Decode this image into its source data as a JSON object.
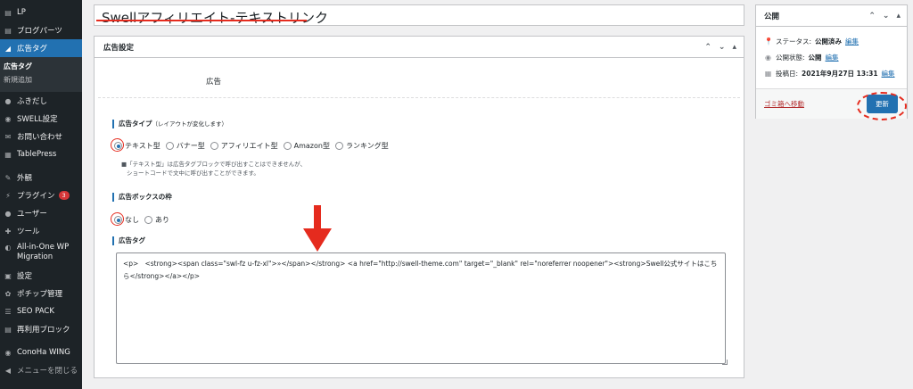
{
  "sidebar": {
    "items_top": [
      {
        "icon": "lp-icon",
        "label": "LP"
      },
      {
        "icon": "blog-parts-icon",
        "label": "ブログパーツ"
      }
    ],
    "active": {
      "icon": "megaphone-icon",
      "label": "広告タグ"
    },
    "sub": [
      "広告タグ",
      "新規追加"
    ],
    "items_mid": [
      {
        "icon": "speech-bubble-icon",
        "label": "ふきだし"
      },
      {
        "icon": "swell-icon",
        "label": "SWELL設定"
      },
      {
        "icon": "mail-icon",
        "label": "お問い合わせ"
      },
      {
        "icon": "table-icon",
        "label": "TablePress"
      }
    ],
    "items_bottom": [
      {
        "icon": "appearance-icon",
        "label": "外観"
      },
      {
        "icon": "plugin-icon",
        "label": "プラグイン",
        "badge": "3"
      },
      {
        "icon": "users-icon",
        "label": "ユーザー"
      },
      {
        "icon": "tools-icon",
        "label": "ツール"
      },
      {
        "icon": "migration-icon",
        "label": "All-in-One WP Migration"
      },
      {
        "icon": "settings-icon",
        "label": "設定"
      },
      {
        "icon": "pochipp-icon",
        "label": "ポチップ管理"
      },
      {
        "icon": "seo-icon",
        "label": "SEO PACK"
      },
      {
        "icon": "reusable-block-icon",
        "label": "再利用ブロック"
      },
      {
        "icon": "conoha-icon",
        "label": "ConoHa WING"
      },
      {
        "icon": "collapse-icon",
        "label": "メニューを閉じる"
      }
    ]
  },
  "title": {
    "value": "Swellアフィリエイト-テキストリンク"
  },
  "postbox": {
    "heading": "広告設定",
    "ad_label": "広告",
    "type_section": {
      "title": "広告タイプ",
      "hint": "（レイアウトが変化します）"
    },
    "type_options": [
      "テキスト型",
      "バナー型",
      "アフィリエイト型",
      "Amazon型",
      "ランキング型"
    ],
    "type_selected": "テキスト型",
    "note_lines": [
      "■「テキスト型」は広告タグブロックで呼び出すことはできませんが、",
      "ショートコードで文中に呼び出すことができます。"
    ],
    "border_section": {
      "title": "広告ボックスの枠"
    },
    "border_options": [
      "なし",
      "あり"
    ],
    "border_selected": "なし",
    "tag_section": {
      "title": "広告タグ"
    },
    "tag_value": "<p>   <strong><span class=\"swl-fz u-fz-xl\">»</span></strong> <a href=\"http://swell-theme.com\" target=\"_blank\" rel=\"noreferrer noopener\"><strong>Swell公式サイトはこちら</strong></a></p>"
  },
  "publish": {
    "heading": "公開",
    "status_label": "ステータス:",
    "status_value": "公開済み",
    "visibility_label": "公開状態:",
    "visibility_value": "公開",
    "date_label": "投稿日:",
    "date_value": "2021年9月27日 13:31",
    "edit_label": "編集",
    "trash_label": "ゴミ箱へ移動",
    "update_label": "更新"
  },
  "colors": {
    "accent": "#2271b1",
    "annotation": "#e52b1e",
    "sidebar": "#1d2327"
  }
}
